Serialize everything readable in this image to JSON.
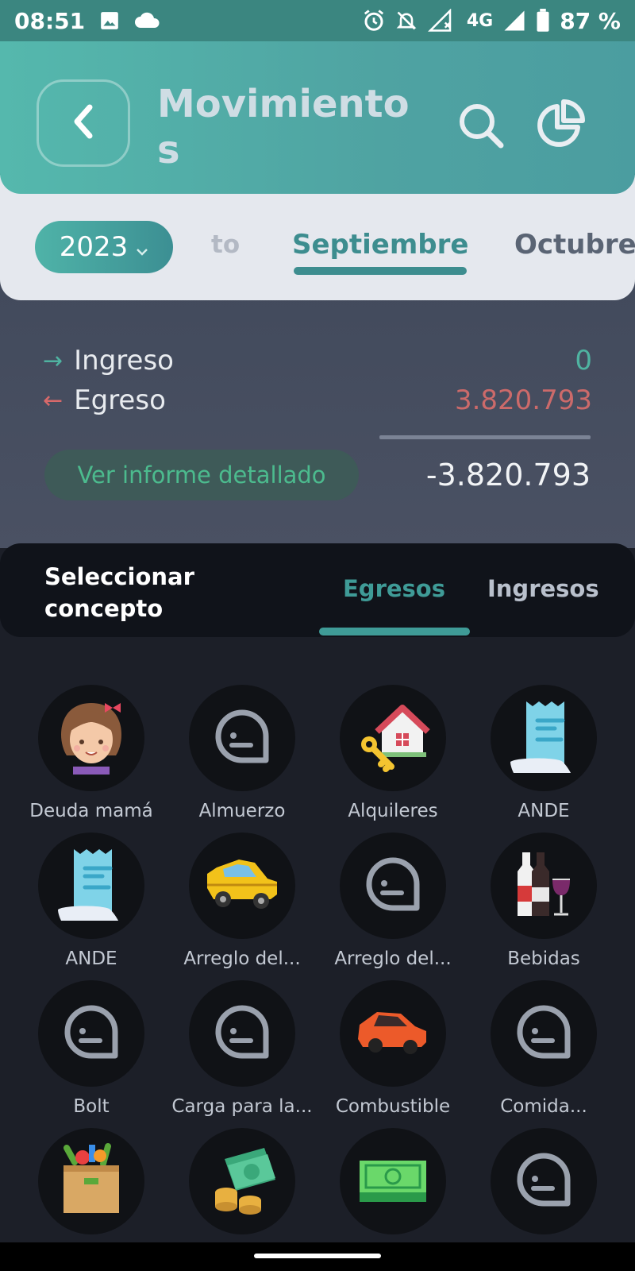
{
  "status_bar": {
    "time": "08:51",
    "network": "4G",
    "battery": "87 %",
    "icons_left": [
      "image-icon",
      "cloud-icon"
    ],
    "icons_right": [
      "alarm-icon",
      "notifications-off-icon",
      "signal-icon",
      "signal-full-icon",
      "battery-icon"
    ]
  },
  "header": {
    "title": "Movimientos",
    "back_icon": "chevron-left-icon",
    "search_icon": "search-icon",
    "chart_icon": "pie-chart-icon"
  },
  "period": {
    "year": "2023",
    "to_label": "to",
    "month_active": "Septiembre",
    "month_next": "Octubre"
  },
  "summary": {
    "income_label": "Ingreso",
    "income_value": "0",
    "expense_label": "Egreso",
    "expense_value": "3.820.793",
    "report_button": "Ver informe detallado",
    "total": "-3.820.793"
  },
  "concept_bar": {
    "title": "Seleccionar concepto",
    "tab_expenses": "Egresos",
    "tab_income": "Ingresos"
  },
  "concepts": [
    {
      "label": "Deuda mamá",
      "icon": "girl-face-icon"
    },
    {
      "label": "Almuerzo",
      "icon": "generic-bubble-icon"
    },
    {
      "label": "Alquileres",
      "icon": "house-key-icon"
    },
    {
      "label": "ANDE",
      "icon": "receipt-icon"
    },
    {
      "label": "ANDE",
      "icon": "receipt-icon"
    },
    {
      "label": "Arreglo del...",
      "icon": "yellow-car-icon"
    },
    {
      "label": "Arreglo del...",
      "icon": "generic-bubble-icon"
    },
    {
      "label": "Bebidas",
      "icon": "bottles-wine-icon"
    },
    {
      "label": "Bolt",
      "icon": "generic-bubble-icon"
    },
    {
      "label": "Carga para la...",
      "icon": "generic-bubble-icon"
    },
    {
      "label": "Combustible",
      "icon": "red-car-icon"
    },
    {
      "label": "Comida...",
      "icon": "generic-bubble-icon"
    },
    {
      "label": "",
      "icon": "groceries-bag-icon"
    },
    {
      "label": "",
      "icon": "cash-coins-icon"
    },
    {
      "label": "",
      "icon": "banknote-icon"
    },
    {
      "label": "",
      "icon": "generic-bubble-icon"
    }
  ],
  "colors": {
    "accent": "#3f9b97",
    "income": "#4fb3a1",
    "expense": "#cc6a6a"
  }
}
